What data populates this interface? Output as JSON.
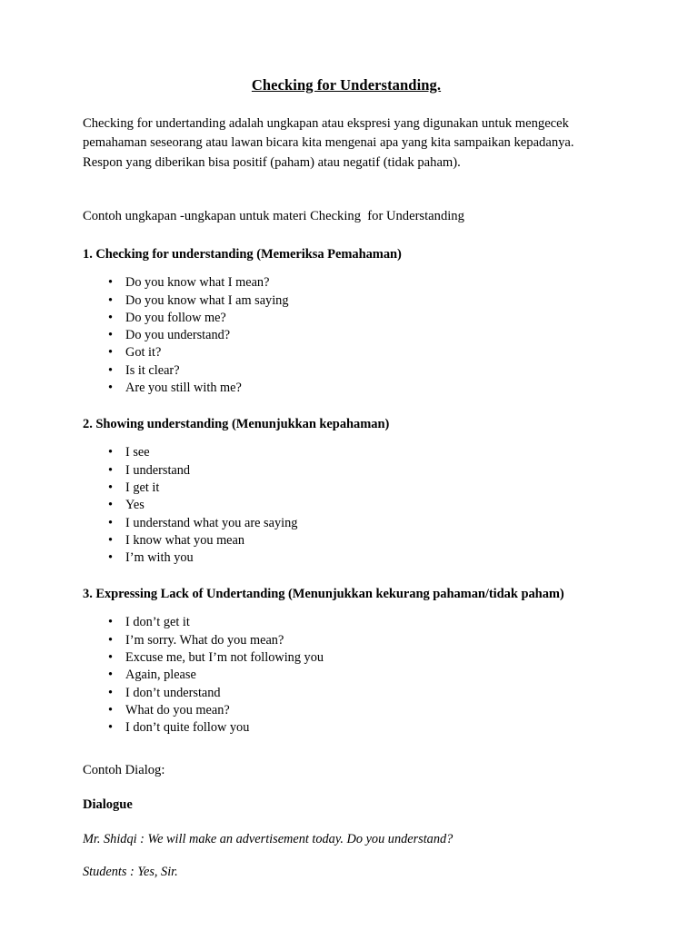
{
  "document": {
    "title": "Checking for Understanding.",
    "intro_paragraph": "Checking for undertanding adalah ungkapan atau ekspresi yang digunakan untuk mengecek pemahaman seseorang atau lawan bicara kita mengenai apa yang kita sampaikan kepadanya. Respon yang diberikan bisa positif (paham) atau negatif (tidak paham).",
    "lead_line": "Contoh ungkapan -ungkapan untuk materi Checking  for Understanding",
    "bullet_glyph": "•",
    "sections": [
      {
        "heading": "1. Checking for understanding (Memeriksa Pemahaman)",
        "items": [
          "Do you know what I mean?",
          "Do you know what I am saying",
          "Do you follow me?",
          "Do you understand?",
          "Got it?",
          "Is it clear?",
          "Are you still with me?"
        ]
      },
      {
        "heading": "2. Showing understanding (Menunjukkan kepahaman)",
        "items": [
          "I see",
          "I understand",
          "I get it",
          "Yes",
          "I understand what you are saying",
          "I know what you mean",
          "I’m with you"
        ]
      },
      {
        "heading": "3. Expressing Lack of Undertanding (Menunjukkan kekurang pahaman/tidak paham)",
        "items": [
          "I don’t get it",
          "I’m sorry. What do you mean?",
          "Excuse me, but I’m not following you",
          "Again, please",
          "I don’t understand",
          "What do you mean?",
          "I don’t quite follow you"
        ]
      }
    ],
    "dialog": {
      "contoh_label": "Contoh Dialog:",
      "heading": "Dialogue",
      "lines": [
        "Mr. Shidqi : We will make an advertisement today. Do you understand?",
        "Students : Yes, Sir."
      ]
    }
  }
}
